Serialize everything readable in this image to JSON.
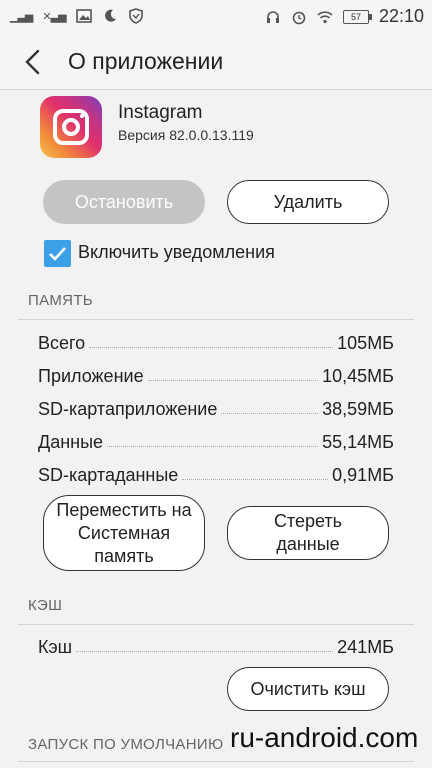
{
  "status_bar": {
    "signal_text": "ill",
    "signal_text2": "ill",
    "battery": "57",
    "time": "22:10"
  },
  "header": {
    "title": "О приложении"
  },
  "app": {
    "name": "Instagram",
    "version": "Версия 82.0.0.13.119"
  },
  "actions": {
    "stop_label": "Остановить",
    "delete_label": "Удалить"
  },
  "notifications": {
    "label": "Включить уведомления",
    "checked": true
  },
  "memory": {
    "section_title": "ПАМЯТЬ",
    "rows": [
      {
        "label": "Всего",
        "value": "105МБ"
      },
      {
        "label": "Приложение",
        "value": "10,45МБ"
      },
      {
        "label": "SD-картаприложение",
        "value": "38,59МБ"
      },
      {
        "label": "Данные",
        "value": "55,14МБ"
      },
      {
        "label": "SD-картаданные",
        "value": "0,91МБ"
      }
    ],
    "move_label": "Переместить на Системная память",
    "clear_data_label": "Стереть данные"
  },
  "cache": {
    "section_title": "КЭШ",
    "rows": [
      {
        "label": "Кэш",
        "value": "241МБ"
      }
    ],
    "clear_cache_label": "Очистить кэш"
  },
  "defaults": {
    "section_title": "ЗАПУСК ПО УМОЛЧАНИЮ"
  },
  "watermark": "ru-android.com",
  "colors": {
    "accent": "#3ba0e6",
    "disabled_button": "#c4c4c4"
  }
}
